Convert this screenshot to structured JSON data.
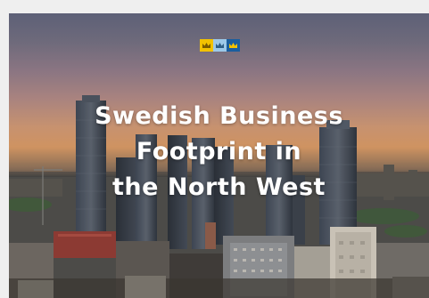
{
  "hero": {
    "title_lines": [
      "Swedish Business",
      "Footprint in",
      "the North West"
    ],
    "logo": {
      "icons": [
        "crown-icon",
        "crown-icon",
        "crown-icon"
      ],
      "colors": [
        "#f2c200",
        "#9cc8e8",
        "#1a5e9e"
      ]
    },
    "colors": {
      "sky_top": "#5d6077",
      "sunset": "#cf9361",
      "title_text": "#ffffff"
    }
  }
}
